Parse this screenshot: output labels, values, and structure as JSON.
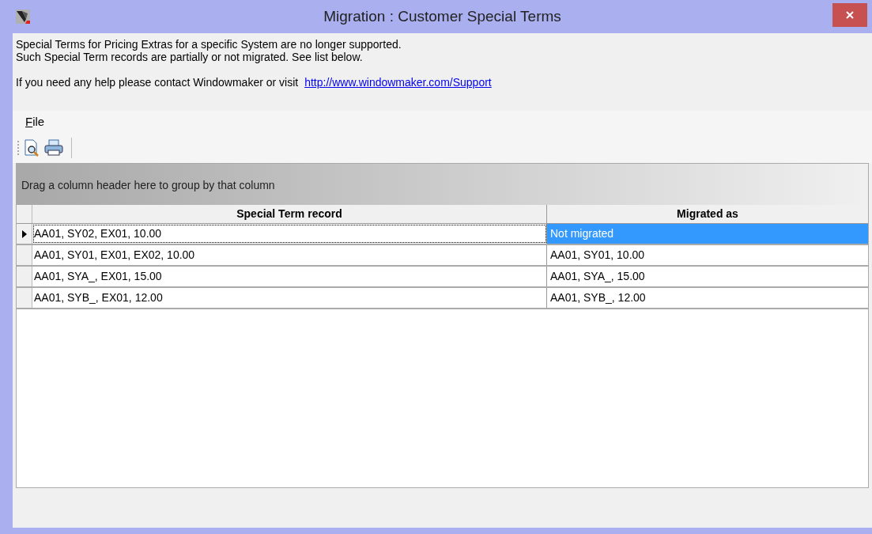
{
  "window": {
    "title": "Migration : Customer Special Terms"
  },
  "info": {
    "lines": [
      "Special Terms for Pricing Extras for a specific System are no longer supported.",
      "Such Special Term records are partially or not migrated. See list below."
    ],
    "help_text": "If you need any help please contact Windowmaker or visit",
    "link": "http://www.windowmaker.com/Support"
  },
  "menu": [
    {
      "label": "File"
    }
  ],
  "grid": {
    "group_panel": "Drag a column header here to group by that column",
    "columns": [
      "Special Term record",
      "Migrated as"
    ],
    "rows": [
      {
        "record": "AA01, SY02, EX01, 10.00",
        "migrated_as": "Not migrated",
        "selected": true
      },
      {
        "record": "AA01, SY01, EX01, EX02, 10.00",
        "migrated_as": "AA01, SY01, 10.00",
        "selected": false
      },
      {
        "record": "AA01, SYA_, EX01, 15.00",
        "migrated_as": "AA01, SYA_, 15.00",
        "selected": false
      },
      {
        "record": "AA01, SYB_, EX01, 12.00",
        "migrated_as": "AA01, SYB_, 12.00",
        "selected": false
      }
    ]
  }
}
